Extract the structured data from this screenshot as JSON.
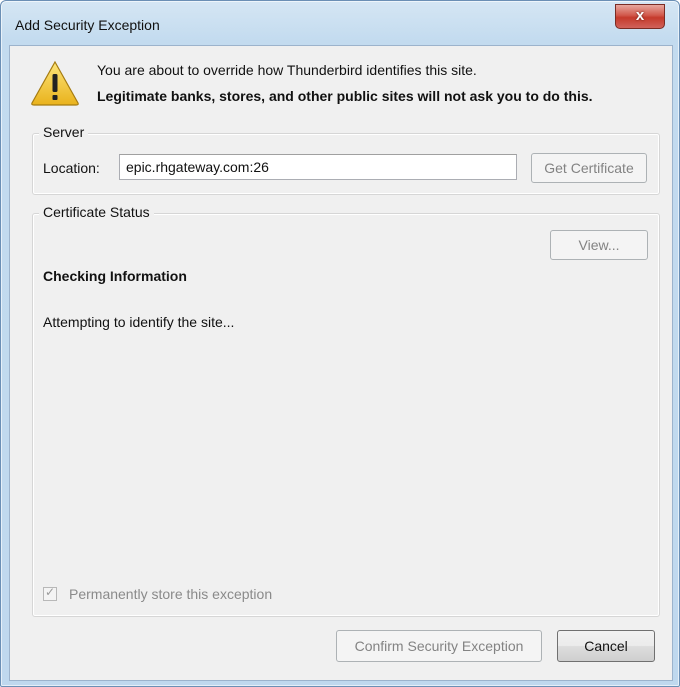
{
  "window": {
    "title": "Add Security Exception",
    "close_label": "x"
  },
  "warning": {
    "icon": "warning-triangle-icon",
    "line1": "You are about to override how Thunderbird identifies this site.",
    "line2": "Legitimate banks, stores, and other public sites will not ask you to do this."
  },
  "server": {
    "group_label": "Server",
    "location_label": "Location:",
    "location_value": "epic.rhgateway.com:26",
    "get_certificate_label": "Get Certificate"
  },
  "certificate_status": {
    "group_label": "Certificate Status",
    "view_label": "View...",
    "heading": "Checking Information",
    "message": "Attempting to identify the site...",
    "permanently_store_label": "Permanently store this exception",
    "permanently_store_checked": true
  },
  "footer": {
    "confirm_label": "Confirm Security Exception",
    "cancel_label": "Cancel"
  },
  "colors": {
    "close_button": "#c53a2b",
    "warning_yellow": "#f4c430",
    "titlebar": "#c3dbef"
  }
}
